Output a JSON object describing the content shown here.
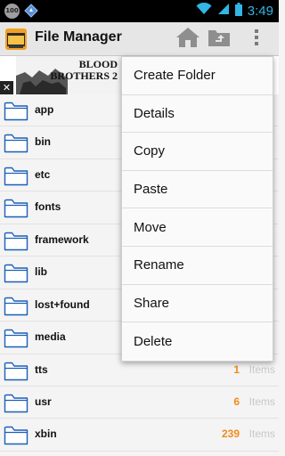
{
  "status_bar": {
    "badge_text": "100",
    "time": "3:49",
    "icons": [
      "notification-badge-icon",
      "navigation-diamond-icon",
      "wifi-icon",
      "signal-icon",
      "battery-icon"
    ]
  },
  "action_bar": {
    "title": "File Manager",
    "buttons": [
      "home-icon",
      "parent-folder-icon",
      "overflow-menu-icon"
    ]
  },
  "ad": {
    "title_line1": "BLOOD",
    "title_line2": "BROTHERS 2",
    "close_label": "✕"
  },
  "files": [
    {
      "name": "app",
      "count": "",
      "unit": ""
    },
    {
      "name": "bin",
      "count": "",
      "unit": ""
    },
    {
      "name": "etc",
      "count": "",
      "unit": ""
    },
    {
      "name": "fonts",
      "count": "",
      "unit": ""
    },
    {
      "name": "framework",
      "count": "",
      "unit": ""
    },
    {
      "name": "lib",
      "count": "",
      "unit": ""
    },
    {
      "name": "lost+found",
      "count": "",
      "unit": ""
    },
    {
      "name": "media",
      "count": "",
      "unit": ""
    },
    {
      "name": "tts",
      "count": "1",
      "unit": "Items"
    },
    {
      "name": "usr",
      "count": "6",
      "unit": "Items"
    },
    {
      "name": "xbin",
      "count": "239",
      "unit": "Items"
    }
  ],
  "menu": {
    "items": [
      "Create Folder",
      "Details",
      "Copy",
      "Paste",
      "Move",
      "Rename",
      "Share",
      "Delete"
    ]
  },
  "colors": {
    "accent_blue": "#33b5e5",
    "count_orange": "#f28a1c",
    "folder_outline": "#1c5fb8"
  }
}
